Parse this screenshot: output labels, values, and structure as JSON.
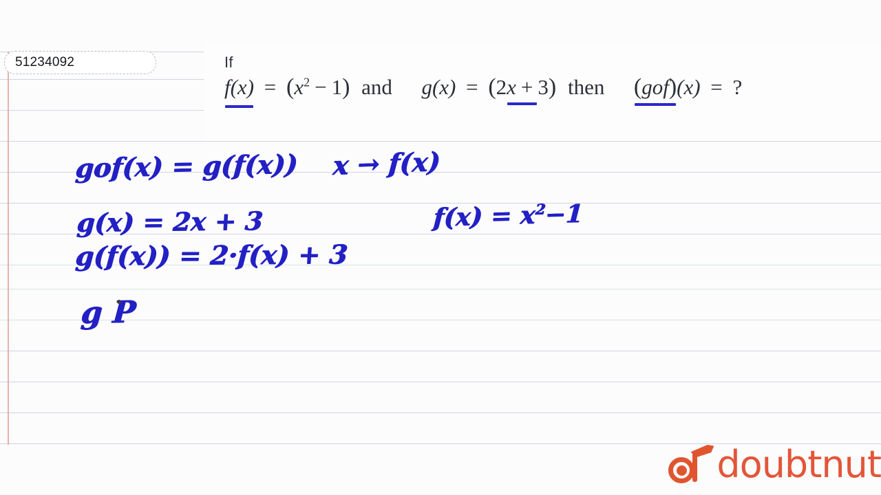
{
  "question_id": "51234092",
  "question": {
    "prefix": "If",
    "f_label": "f(x)",
    "eq1": "=",
    "f_open": "(",
    "f_var": "x",
    "f_exp": "2",
    "f_minus": "−",
    "f_one": "1",
    "f_close": ")",
    "and": "and",
    "g_label": "g(x)",
    "eq2": "=",
    "g_open": "(",
    "g_two": "2",
    "g_var": "x",
    "g_plus": "+",
    "g_three": "3",
    "g_close": ")",
    "then": "then",
    "comp_open": "(",
    "comp": "gof",
    "comp_close": ")",
    "comp_arg": "(x)",
    "eq3": "=",
    "qmark": "?"
  },
  "solution": {
    "line1_left": "gof(x)  =  g(f(x))",
    "line1_right": "x → f(x)",
    "line2_left": "g(x)  =  2x + 3",
    "line2_right_pre": "f(x) = x",
    "line2_right_exp": "2",
    "line2_right_post": "−1",
    "line3_left": "g(f(x))  =  2·f(x) + 3",
    "line4_left": "g P"
  },
  "branding": {
    "logo_text": "doubtnut",
    "logo_color": "#e2563a"
  },
  "ink": {
    "color": "#2320c4",
    "underline_color": "#2a28c8"
  },
  "paper": {
    "rule_color": "#c9ced6",
    "margin_color": "#e2a9a2",
    "background": "#fcfcfd"
  }
}
